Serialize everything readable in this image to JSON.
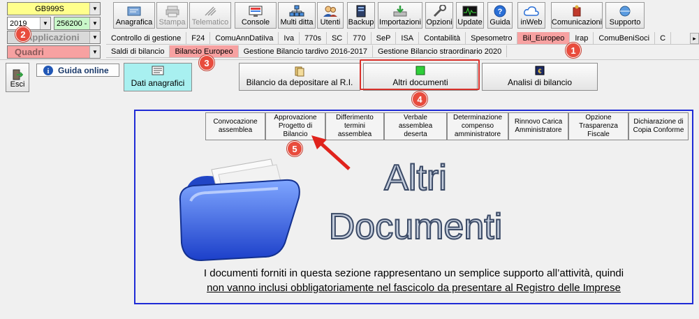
{
  "toolbar": {
    "company_combo": "GB999S",
    "year_combo": "2019",
    "code_combo": "256200 -",
    "applicazioni_label": "Applicazioni",
    "quadri_label": "Quadri",
    "buttons": [
      {
        "label": "Anagrafica",
        "icon": "anagrafica-icon"
      },
      {
        "label": "Stampa",
        "icon": "printer-icon"
      },
      {
        "label": "Telematico",
        "icon": "telematico-icon"
      },
      {
        "label": "Console",
        "icon": "console-icon"
      },
      {
        "label": "Multi ditta",
        "icon": "multi-ditta-icon"
      },
      {
        "label": "Utenti",
        "icon": "users-icon"
      },
      {
        "label": "Backup",
        "icon": "backup-icon"
      },
      {
        "label": "Importazioni",
        "icon": "import-icon"
      },
      {
        "label": "Opzioni",
        "icon": "options-icon"
      },
      {
        "label": "Update",
        "icon": "update-icon"
      },
      {
        "label": "Guida",
        "icon": "help-icon"
      },
      {
        "label": "inWeb",
        "icon": "cloud-icon"
      },
      {
        "label": "Comunicazioni",
        "icon": "comunicazioni-icon"
      },
      {
        "label": "Supporto",
        "icon": "support-icon"
      }
    ]
  },
  "app_tabs": [
    "Controllo di gestione",
    "F24",
    "ComuAnnDatiIva",
    "Iva",
    "770s",
    "SC",
    "770",
    "SeP",
    "ISA",
    "Contabilità",
    "Spesometro",
    "Bil_Europeo",
    "Irap",
    "ComuBeniSoci",
    "C"
  ],
  "quadri_tabs": [
    "Saldi di bilancio",
    "Bilancio Europeo",
    "Gestione Bilancio tardivo 2016-2017",
    "Gestione Bilancio straordinario 2020"
  ],
  "left": {
    "esci_label": "Esci",
    "guida_online_label": "Guida online",
    "dati_anagrafici_label": "Dati anagrafici"
  },
  "sections": [
    {
      "label": "Bilancio da depositare al R.I."
    },
    {
      "label": "Altri documenti"
    },
    {
      "label": "Analisi di bilancio"
    }
  ],
  "sub_tabs": [
    {
      "label": "Convocazione assemblea"
    },
    {
      "label": "Approvazione Progetto di Bilancio"
    },
    {
      "label": "Differimento termini assemblea"
    },
    {
      "label": "Verbale assemblea deserta"
    },
    {
      "label": "Determinazione compenso amministratore"
    },
    {
      "label": "Rinnovo Carica Amministratore"
    },
    {
      "label": "Opzione Trasparenza Fiscale"
    },
    {
      "label": "Dichiarazione di Copia Conforme"
    }
  ],
  "panel": {
    "title_line1": "Altri",
    "title_line2": "Documenti",
    "note_line1": "I documenti forniti in questa sezione rappresentano un semplice supporto all’attività, quindi",
    "note_line2": "non vanno inclusi obbligatoriamente nel fascicolo da presentare al Registro delle Imprese"
  },
  "badges": [
    "1",
    "2",
    "3",
    "4",
    "5"
  ],
  "colors": {
    "active_tab": "#f7a1a1",
    "badge": "#e84c3d",
    "panel_border": "#1f2bd6",
    "highlight_border": "#d9302a",
    "dati_bg": "#a8f0f0"
  }
}
